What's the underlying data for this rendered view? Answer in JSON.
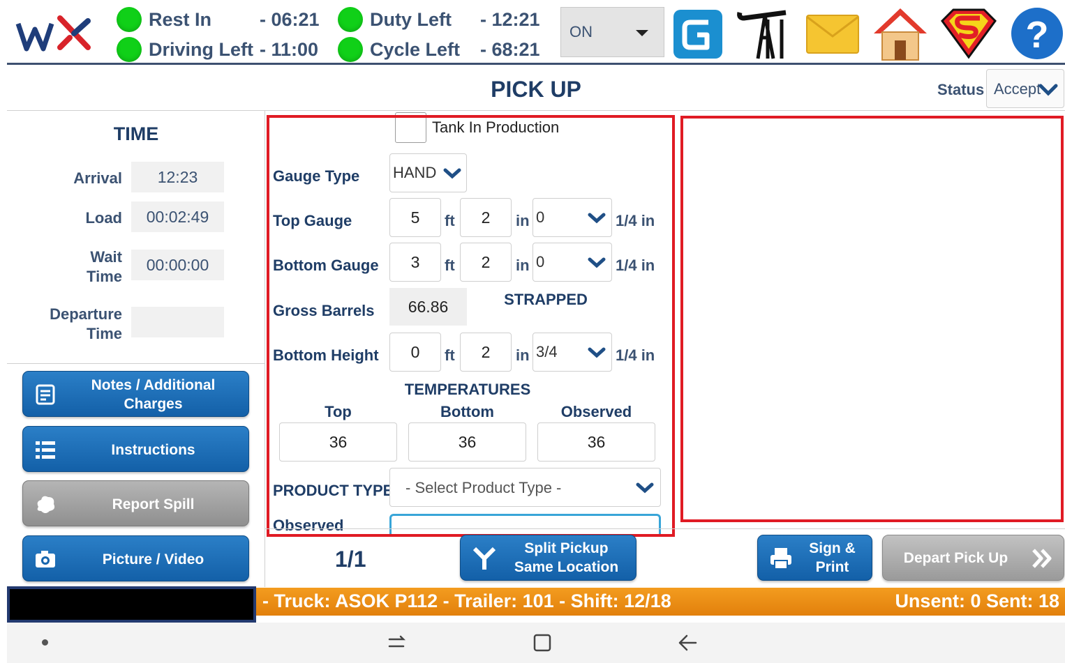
{
  "top_bar": {
    "logo_text": "wx",
    "hos": [
      {
        "label": "Rest In",
        "value": "- 06:21"
      },
      {
        "label": "Driving Left",
        "value": "- 11:00"
      },
      {
        "label": "Duty Left",
        "value": "- 12:21"
      },
      {
        "label": "Cycle Left",
        "value": "- 68:21"
      }
    ],
    "duty_status_select": "ON",
    "icons": [
      "g-logo-icon",
      "oil-pump-icon",
      "mail-icon",
      "home-icon",
      "superman-icon",
      "help-icon"
    ],
    "colors": {
      "status_dot": "#10d018",
      "text": "#3b5272"
    }
  },
  "header": {
    "title": "PICK UP",
    "status_label": "Status",
    "status_value": "Accept"
  },
  "time_panel": {
    "title": "TIME",
    "arrival_label": "Arrival",
    "arrival_value": "12:23",
    "load_label": "Load",
    "load_value": "00:02:49",
    "wait_label_1": "Wait",
    "wait_label_2": "Time",
    "wait_value": "00:00:00",
    "departure_label_1": "Departure",
    "departure_label_2": "Time",
    "departure_value": ""
  },
  "side_buttons": {
    "notes_1": "Notes / Additional",
    "notes_2": "Charges",
    "instructions": "Instructions",
    "report_spill": "Report Spill",
    "picture_video": "Picture / Video"
  },
  "form": {
    "tank_in_production": "Tank In Production",
    "gauge_type_label": "Gauge Type",
    "gauge_type_value": "HAND",
    "top_gauge_label": "Top Gauge",
    "top_gauge_ft": "5",
    "top_gauge_in": "2",
    "top_gauge_quarter": "0",
    "bottom_gauge_label": "Bottom Gauge",
    "bottom_gauge_ft": "3",
    "bottom_gauge_in": "2",
    "bottom_gauge_quarter": "0",
    "gross_barrels_label": "Gross Barrels",
    "gross_barrels_value": "66.86",
    "strapped_label": "STRAPPED",
    "bottom_height_label": "Bottom Height",
    "bottom_height_ft": "0",
    "bottom_height_in": "2",
    "bottom_height_quarter": "3/4",
    "unit_ft": "ft",
    "unit_in": "in",
    "unit_quarter": "1/4 in",
    "temperatures_title": "TEMPERATURES",
    "temp_top_label": "Top",
    "temp_bottom_label": "Bottom",
    "temp_observed_label": "Observed",
    "temp_top_value": "36",
    "temp_bottom_value": "36",
    "temp_observed_value": "36",
    "product_type_label": "PRODUCT TYPE",
    "product_type_placeholder": "- Select Product Type -",
    "observed_label": "Observed"
  },
  "actions": {
    "page_count": "1/1",
    "split_1": "Split Pickup",
    "split_2": "Same Location",
    "sign_1": "Sign &",
    "sign_2": "Print",
    "depart": "Depart Pick Up"
  },
  "status_strip": {
    "truck_info": "- Truck: ASOK P112  -  Trailer: 101  -  Shift: 12/18",
    "sent_info": "Unsent: 0  Sent: 18"
  }
}
